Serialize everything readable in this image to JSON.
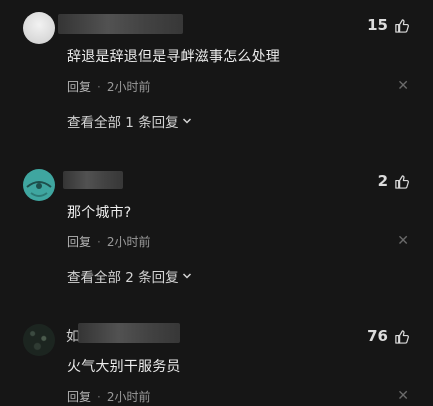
{
  "comments": [
    {
      "likes": "15",
      "text": "辞退是辞退但是寻衅滋事怎么处理",
      "reply_label": "回复",
      "time": "2小时前",
      "expand": "查看全部 1 条回复"
    },
    {
      "likes": "2",
      "text": "那个城市?",
      "reply_label": "回复",
      "time": "2小时前",
      "expand": "查看全部 2 条回复"
    },
    {
      "name_prefix": "如",
      "likes": "76",
      "text": "火气大别干服务员",
      "reply_label": "回复",
      "time": "2小时前"
    }
  ],
  "icons": {
    "like": "thumbs-up-icon",
    "close": "close-icon",
    "expand": "chevron-down-icon",
    "dot": "·",
    "close_glyph": "✕"
  },
  "colors": {
    "background": "#161616",
    "avatar2": "#3fa6a0"
  }
}
